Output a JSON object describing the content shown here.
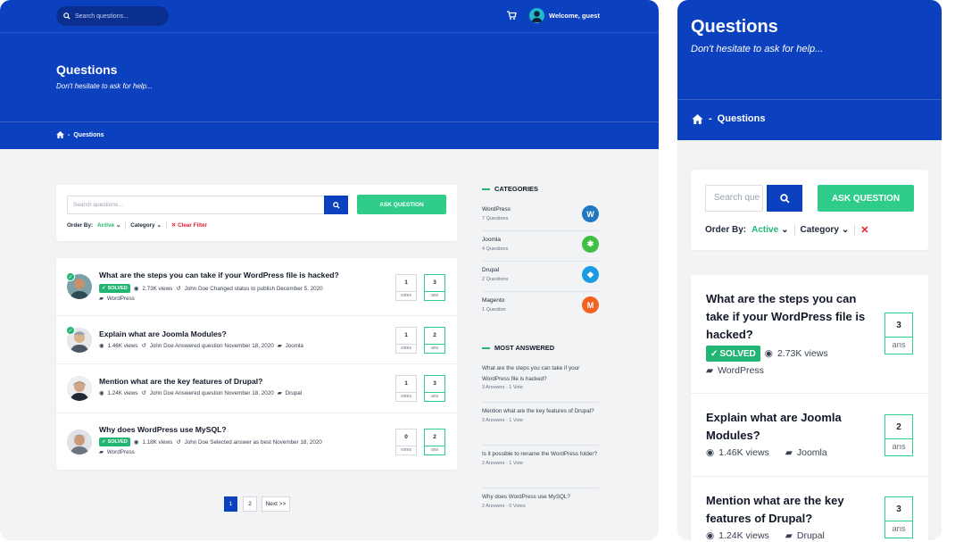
{
  "header": {
    "search_placeholder": "Search questions...",
    "welcome": "Welcome, guest"
  },
  "hero": {
    "title": "Questions",
    "subtitle": "Don't hesitate to ask for help..."
  },
  "breadcrumb": {
    "separator": "-",
    "current": "Questions"
  },
  "filter_card": {
    "search_placeholder": "Search questions...",
    "mobile_search_placeholder": "Search que",
    "ask_label": "ASK QUESTION",
    "order_by_label": "Order By:",
    "order_by_value": "Active",
    "category_label": "Category",
    "clear_filter_label": "Clear Filter"
  },
  "questions": [
    {
      "title": "What are the steps you can take if your WordPress file is hacked?",
      "solved": "SOLVED",
      "views": "2.73K views",
      "activity": "John Doe Changed status to publish December 5, 2020",
      "category": "WordPress",
      "votes": "1",
      "votes_label": "votes",
      "answers": "3",
      "answers_label": "ans"
    },
    {
      "title": "Explain what are Joomla Modules?",
      "views": "1.46K views",
      "activity": "John Doe Answered question November 18, 2020",
      "category": "Joomla",
      "votes": "1",
      "votes_label": "votes",
      "answers": "2",
      "answers_label": "ans"
    },
    {
      "title": "Mention what are the key features of Drupal?",
      "views": "1.24K views",
      "activity": "John Doe Answered question November 18, 2020",
      "category": "Drupal",
      "votes": "1",
      "votes_label": "votes",
      "answers": "3",
      "answers_label": "ans"
    },
    {
      "title": "Why does WordPress use MySQL?",
      "solved": "SOLVED",
      "views": "1.18K views",
      "activity": "John Doe Selected answer as best November 18, 2020",
      "category": "WordPress",
      "votes": "0",
      "votes_label": "votes",
      "answers": "2",
      "answers_label": "ans"
    }
  ],
  "pagination": {
    "pages": [
      "1",
      "2"
    ],
    "next": "Next >>"
  },
  "sidebar": {
    "categories_heading": "CATEGORIES",
    "categories": [
      {
        "name": "WordPress",
        "count": "7 Questions",
        "color": "#1f78c1"
      },
      {
        "name": "Joomla",
        "count": "4 Questions",
        "color": "#3fbf45"
      },
      {
        "name": "Drupal",
        "count": "2 Questions",
        "color": "#1b9ce2"
      },
      {
        "name": "Magento",
        "count": "1 Question",
        "color": "#f26322"
      }
    ],
    "most_answered_heading": "MOST ANSWERED",
    "most_answered": [
      {
        "title": "What are the steps you can take if your WordPress file is hacked?",
        "stats": "3 Answers - 1 Vote"
      },
      {
        "title": "Mention what are the key features of Drupal?",
        "stats": "3 Answers - 1 Vote"
      },
      {
        "title": "Is it possible to rename the WordPress folder?",
        "stats": "2 Answers - 1 Vote"
      },
      {
        "title": "Why does WordPress use MySQL?",
        "stats": "2 Answers - 0 Votes"
      }
    ]
  },
  "mobile": {
    "questions": [
      {
        "title": "What are the steps you can take if your WordPress file is hacked?",
        "solved": "SOLVED",
        "views": "2.73K views",
        "category": "WordPress",
        "answers": "3",
        "answers_label": "ans"
      },
      {
        "title": "Explain what are Joomla Modules?",
        "views": "1.46K views",
        "category": "Joomla",
        "answers": "2",
        "answers_label": "ans"
      },
      {
        "title": "Mention what are the key features of Drupal?",
        "views": "1.24K views",
        "category": "Drupal",
        "answers": "3",
        "answers_label": "ans"
      }
    ]
  },
  "colors": {
    "brand_blue": "#0b40bf",
    "accent_green": "#2fcc8a",
    "danger_red": "#e11d2a"
  }
}
